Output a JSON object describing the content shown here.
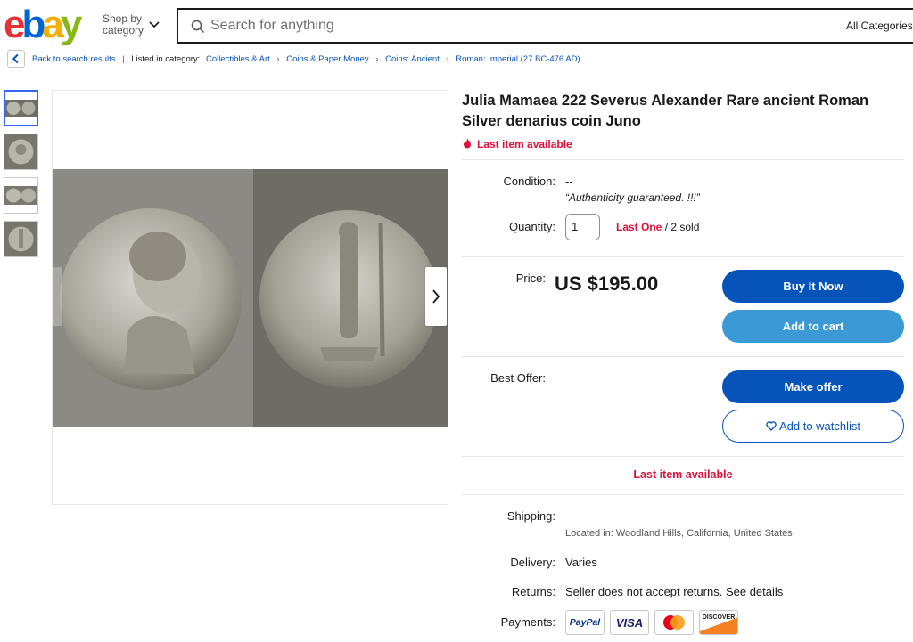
{
  "header": {
    "logo_letters": [
      "e",
      "b",
      "a",
      "y"
    ],
    "logo_colors": [
      "#e53238",
      "#0064d2",
      "#f5af02",
      "#86b817"
    ],
    "shop_by_line1": "Shop by",
    "shop_by_line2": "category",
    "search_placeholder": "Search for anything",
    "category_select": "All Categories"
  },
  "breadcrumb": {
    "back_label": "Back to search results",
    "listed_label": "Listed in category:",
    "items": [
      "Collectibles & Art",
      "Coins & Paper Money",
      "Coins: Ancient",
      "Roman: Imperial (27 BC-476 AD)"
    ]
  },
  "listing": {
    "title": "Julia Mamaea 222 Severus Alexander Rare ancient Roman Silver denarius coin Juno",
    "urgency": "Last item available",
    "condition_label": "Condition:",
    "condition_value": "--",
    "condition_note": "“Authenticity guaranteed. !!!”",
    "quantity_label": "Quantity:",
    "quantity_value": "1",
    "last_one": "Last One",
    "sold": "/ 2 sold",
    "price_label": "Price:",
    "price_value": "US $195.00",
    "buy_now": "Buy It Now",
    "add_to_cart": "Add to cart",
    "best_offer_label": "Best Offer:",
    "make_offer": "Make offer",
    "add_watchlist": "Add to watchlist",
    "last_item_center": "Last item available",
    "shipping_label": "Shipping:",
    "location": "Located in: Woodland Hills, California, United States",
    "delivery_label": "Delivery:",
    "delivery_value": "Varies",
    "returns_label": "Returns:",
    "returns_value": "Seller does not accept returns.",
    "returns_link": "See details",
    "payments_label": "Payments:",
    "payment_methods": [
      "PayPal",
      "VISA",
      "Mastercard",
      "DISCOVER"
    ]
  },
  "colors": {
    "accent_blue": "#0654ba",
    "cart_blue": "#3b9ad6",
    "urgency_red": "#e0103a",
    "link_blue": "#0654ba"
  }
}
